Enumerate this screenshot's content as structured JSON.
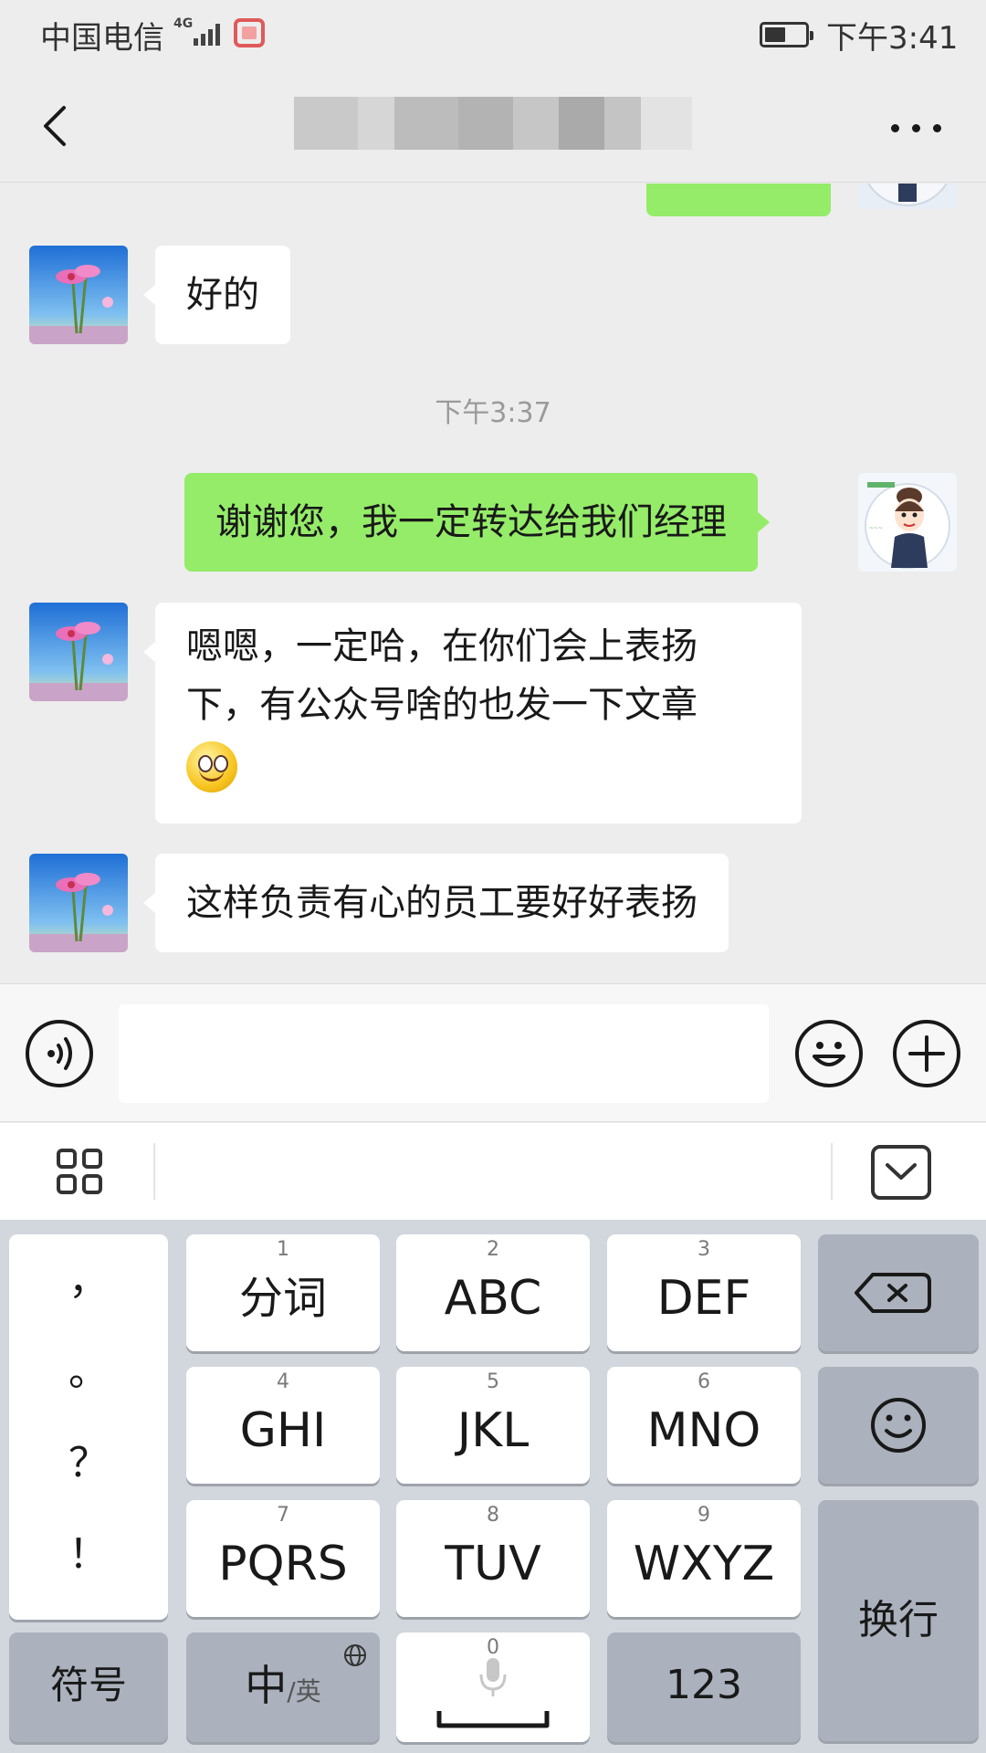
{
  "status_bar": {
    "carrier": "中国电信",
    "network": "4G",
    "time": "下午3:41"
  },
  "chat": {
    "timestamp": "下午3:37",
    "messages": [
      {
        "from": "contact",
        "text": "好的"
      },
      {
        "from": "me",
        "text": "谢谢您，我一定转达给我们经理"
      },
      {
        "from": "contact",
        "line1": "嗯嗯，一定哈，在你们会上表扬",
        "line2": "下，有公众号啥的也发一下文章"
      },
      {
        "from": "contact",
        "text": "这样负责有心的员工要好好表扬"
      }
    ]
  },
  "input_bar": {
    "value": ""
  },
  "keyboard": {
    "punctuation": [
      "，",
      "。",
      "？",
      "！"
    ],
    "rows": [
      [
        {
          "num": "1",
          "label": "分词"
        },
        {
          "num": "2",
          "label": "ABC"
        },
        {
          "num": "3",
          "label": "DEF"
        }
      ],
      [
        {
          "num": "4",
          "label": "GHI"
        },
        {
          "num": "5",
          "label": "JKL"
        },
        {
          "num": "6",
          "label": "MNO"
        }
      ],
      [
        {
          "num": "7",
          "label": "PQRS"
        },
        {
          "num": "8",
          "label": "TUV"
        },
        {
          "num": "9",
          "label": "WXYZ"
        }
      ]
    ],
    "symbols": "符号",
    "lang_main": "中",
    "lang_alt": "/英",
    "space_num": "0",
    "numbers": "123",
    "enter": "换行"
  },
  "icons": {
    "back": "chevron-left-icon",
    "more": "more-dots-icon",
    "voice": "voice-icon",
    "emoji": "emoji-icon",
    "plus": "plus-icon",
    "grid": "grid-icon",
    "hide_keyboard": "chevron-down-icon",
    "backspace": "backspace-icon",
    "emoji_key": "emoji-icon",
    "globe": "globe-icon",
    "mic": "microphone-icon"
  },
  "colors": {
    "sent_bubble": "#95ec69",
    "received_bubble": "#ffffff",
    "background": "#ededed",
    "keyboard_bg": "#d2d6dd"
  }
}
